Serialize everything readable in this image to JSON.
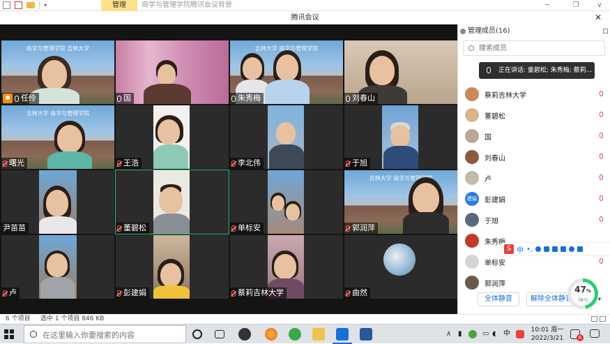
{
  "explorer": {
    "manage_tab": "管理",
    "title": "商学与管理学院腾讯会议背景",
    "minimize": "─",
    "restore": "❐",
    "chevron": "∨"
  },
  "meeting": {
    "title": "腾讯会议",
    "close": "✕"
  },
  "tiles": [
    {
      "label": "任伶",
      "banner": "商学与管理学院 吉林大学"
    },
    {
      "label": "国"
    },
    {
      "label": "朱秀梅",
      "banner": "吉林大学 商学与管理学院"
    },
    {
      "label": "刘春山"
    },
    {
      "label": "曙光",
      "banner": "吉林大学 商学与管理学院"
    },
    {
      "label": "王浩"
    },
    {
      "label": "李北伟"
    },
    {
      "label": "于旭"
    },
    {
      "label": "尹苗苗"
    },
    {
      "label": "董碧松"
    },
    {
      "label": "单标安"
    },
    {
      "label": "郭润萍",
      "banner": "吉林大学 商学与管理学院"
    },
    {
      "label": "卢"
    },
    {
      "label": "彭建娟"
    },
    {
      "label": "蔡莉吉林大学"
    },
    {
      "label": "曲然"
    }
  ],
  "sidebar": {
    "header": "管理成员(16)",
    "search_placeholder": "搜索成员",
    "speaking": "正在讲话: 董碧松; 朱秀梅; 蔡莉...",
    "members": [
      {
        "name": "蔡莉吉林大学"
      },
      {
        "name": "董碧松"
      },
      {
        "name": "国"
      },
      {
        "name": "刘春山"
      },
      {
        "name": "卢"
      },
      {
        "name": "彭建娟",
        "avatar_text": "建娟"
      },
      {
        "name": "于旭"
      },
      {
        "name": "朱秀梅"
      },
      {
        "name": "单标安"
      },
      {
        "name": "郭润萍"
      }
    ],
    "mute_all": "全体静音",
    "unmute_all": "解除全体静音"
  },
  "ime": {
    "lang": "中",
    "dot": "•,"
  },
  "gauge": {
    "percent": "47",
    "unit": "%",
    "temp": "78°C",
    "value": 0.47
  },
  "statusbar": {
    "items": "6 个项目",
    "selected": "选中 1 个项目  846 KB"
  },
  "taskbar": {
    "search_placeholder": "在这里输入你要搜索的内容",
    "ime": "中",
    "time": "10:01 周一",
    "date": "2022/3/21",
    "notif_count": "6"
  },
  "colors": {
    "accent": "#1a6fd6",
    "host": "#f08c1a",
    "gauge": "#2ecc71"
  }
}
